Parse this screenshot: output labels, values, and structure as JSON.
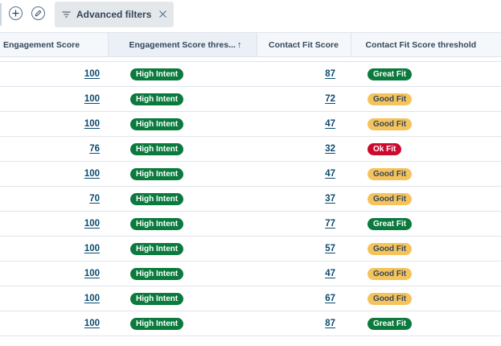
{
  "toolbar": {
    "add_icon": "plus-circle-icon",
    "edit_icon": "pencil-circle-icon",
    "advanced_filters_label": "Advanced filters",
    "filter_icon": "filter-lines-icon",
    "close_icon": "close-icon"
  },
  "table": {
    "columns": [
      {
        "label": "Engagement Score"
      },
      {
        "label": "Engagement Score thres...",
        "sort": "ascending",
        "sort_glyph": "↑"
      },
      {
        "label": "Contact Fit Score"
      },
      {
        "label": "Contact Fit Score threshold"
      }
    ],
    "rows": [
      {
        "engagement_score": "100",
        "engagement_threshold": "High Intent",
        "fit_score": "87",
        "fit_threshold": "Great Fit",
        "fit_color": "green"
      },
      {
        "engagement_score": "100",
        "engagement_threshold": "High Intent",
        "fit_score": "72",
        "fit_threshold": "Good Fit",
        "fit_color": "yellow"
      },
      {
        "engagement_score": "100",
        "engagement_threshold": "High Intent",
        "fit_score": "47",
        "fit_threshold": "Good Fit",
        "fit_color": "yellow"
      },
      {
        "engagement_score": "76",
        "engagement_threshold": "High Intent",
        "fit_score": "32",
        "fit_threshold": "Ok Fit",
        "fit_color": "red"
      },
      {
        "engagement_score": "100",
        "engagement_threshold": "High Intent",
        "fit_score": "47",
        "fit_threshold": "Good Fit",
        "fit_color": "yellow"
      },
      {
        "engagement_score": "70",
        "engagement_threshold": "High Intent",
        "fit_score": "37",
        "fit_threshold": "Good Fit",
        "fit_color": "yellow"
      },
      {
        "engagement_score": "100",
        "engagement_threshold": "High Intent",
        "fit_score": "77",
        "fit_threshold": "Great Fit",
        "fit_color": "green"
      },
      {
        "engagement_score": "100",
        "engagement_threshold": "High Intent",
        "fit_score": "57",
        "fit_threshold": "Good Fit",
        "fit_color": "yellow"
      },
      {
        "engagement_score": "100",
        "engagement_threshold": "High Intent",
        "fit_score": "47",
        "fit_threshold": "Good Fit",
        "fit_color": "yellow"
      },
      {
        "engagement_score": "100",
        "engagement_threshold": "High Intent",
        "fit_score": "67",
        "fit_threshold": "Good Fit",
        "fit_color": "yellow"
      },
      {
        "engagement_score": "100",
        "engagement_threshold": "High Intent",
        "fit_score": "87",
        "fit_threshold": "Great Fit",
        "fit_color": "green"
      }
    ]
  },
  "colors": {
    "green": "#0a7a3d",
    "yellow": "#f5c35c",
    "red": "#cc0a2e",
    "link": "#0b4a6f"
  }
}
